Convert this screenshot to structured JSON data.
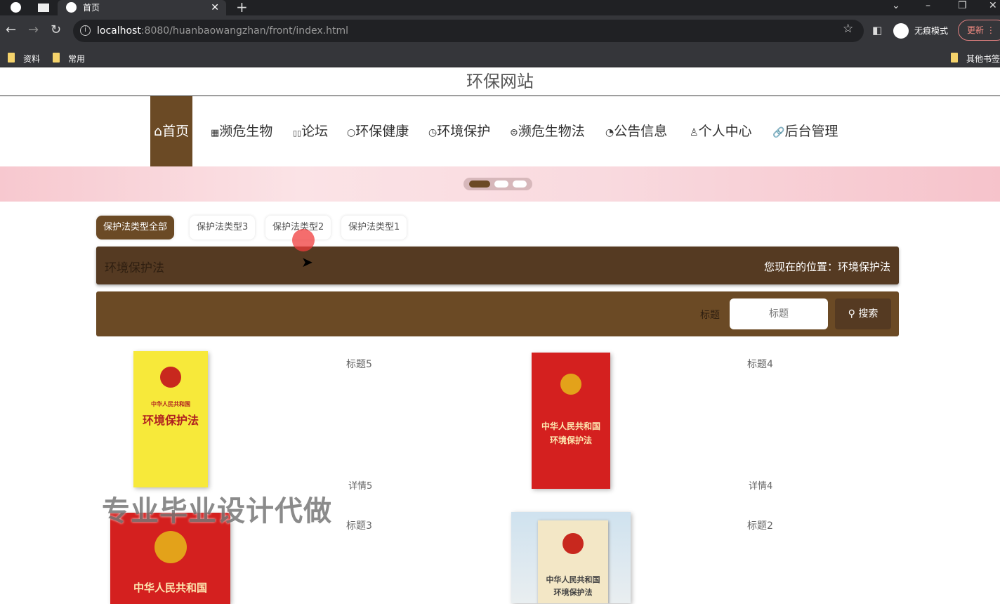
{
  "browser": {
    "tab_title": "首页",
    "url_host": "localhost",
    "url_rest": ":8080/huanbaowangzhan/front/index.html",
    "incognito_label": "无痕模式",
    "update_label": "更新",
    "bookmarks": [
      "资料",
      "常用"
    ],
    "other_bookmarks": "其他书签"
  },
  "site": {
    "title": "环保网站"
  },
  "nav": [
    {
      "icon": "⌂",
      "label": "首页"
    },
    {
      "icon": "▦",
      "label": "濒危生物"
    },
    {
      "icon": "▯▯",
      "label": "论坛"
    },
    {
      "icon": "○",
      "label": "环保健康"
    },
    {
      "icon": "◷",
      "label": "环境保护"
    },
    {
      "icon": "⊜",
      "label": "濒危生物法"
    },
    {
      "icon": "◔",
      "label": "公告信息"
    },
    {
      "icon": "♙",
      "label": "个人中心"
    },
    {
      "icon": "🔗",
      "label": "后台管理"
    }
  ],
  "filters": [
    "保护法类型全部",
    "保护法类型3",
    "保护法类型2",
    "保护法类型1"
  ],
  "breadcrumb": {
    "title": "环境保护法",
    "location": "您现在的位置：环境保护法"
  },
  "search": {
    "label": "标题",
    "placeholder": "标题",
    "button": "搜索"
  },
  "items": [
    {
      "title": "标题5",
      "detail": "详情5",
      "cover_line1": "中华人民共和国",
      "cover_line2": "环境保护法"
    },
    {
      "title": "标题4",
      "detail": "详情4",
      "cover_line1": "中华人民共和国",
      "cover_line2": "环境保护法"
    },
    {
      "title": "标题3",
      "cover_line1": "中华人民共和国"
    },
    {
      "title": "标题2",
      "cover_line1": "中华人民共和国",
      "cover_line2": "环境保护法"
    }
  ],
  "watermark": "专业毕业设计代做"
}
